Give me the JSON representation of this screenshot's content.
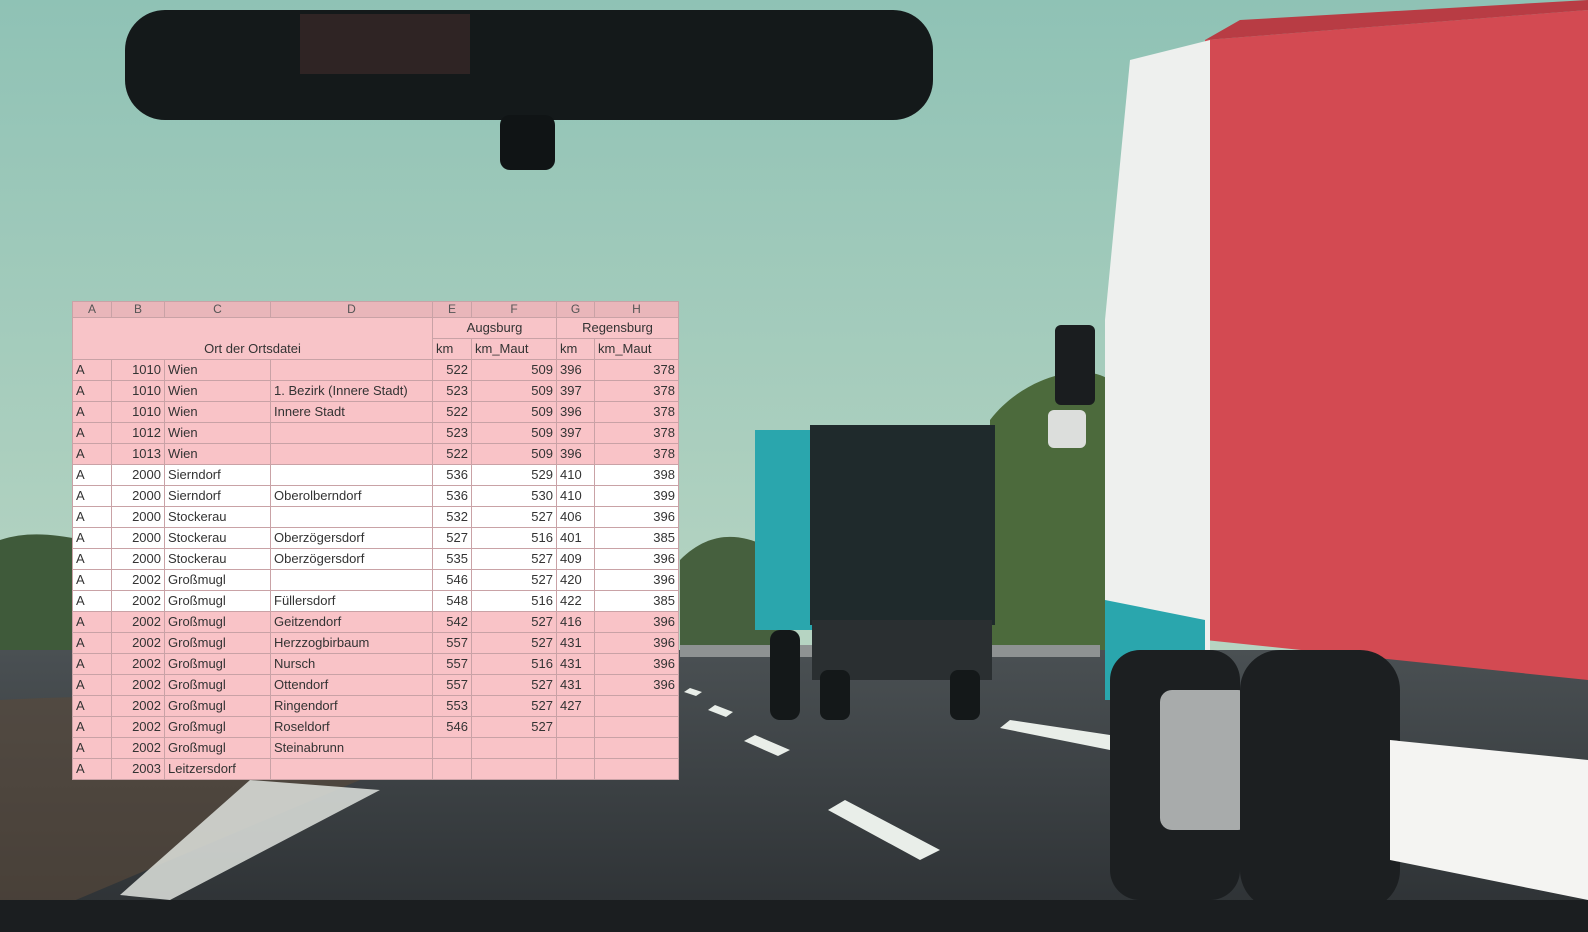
{
  "colors": {
    "sky": "#a9cfc2",
    "road": "#3f4447",
    "pink_row": "#f9c3c7",
    "white_row": "#ffffff",
    "truck_red": "#d34a52",
    "truck_teal": "#2aa6ad"
  },
  "icons": [
    "rearview-mirror",
    "truck-red",
    "truck-teal"
  ],
  "sheet": {
    "columns": [
      "A",
      "B",
      "C",
      "D",
      "E",
      "F",
      "G",
      "H"
    ],
    "header": {
      "group1": "Augsburg",
      "group2": "Regensburg",
      "left_title": "Ort der Ortsdatei",
      "sub": [
        "km",
        "km_Maut",
        "km",
        "km_Maut"
      ]
    },
    "rows": [
      {
        "c": "A",
        "plz": "1010",
        "ort": "Wien",
        "ortsteil": "",
        "e": "522",
        "f": "509",
        "g": "396",
        "h": "378",
        "shade": "pink"
      },
      {
        "c": "A",
        "plz": "1010",
        "ort": "Wien",
        "ortsteil": "1. Bezirk (Innere Stadt)",
        "e": "523",
        "f": "509",
        "g": "397",
        "h": "378",
        "shade": "pink"
      },
      {
        "c": "A",
        "plz": "1010",
        "ort": "Wien",
        "ortsteil": "Innere Stadt",
        "e": "522",
        "f": "509",
        "g": "396",
        "h": "378",
        "shade": "pink"
      },
      {
        "c": "A",
        "plz": "1012",
        "ort": "Wien",
        "ortsteil": "",
        "e": "523",
        "f": "509",
        "g": "397",
        "h": "378",
        "shade": "pink"
      },
      {
        "c": "A",
        "plz": "1013",
        "ort": "Wien",
        "ortsteil": "",
        "e": "522",
        "f": "509",
        "g": "396",
        "h": "378",
        "shade": "pink"
      },
      {
        "c": "A",
        "plz": "2000",
        "ort": "Sierndorf",
        "ortsteil": "",
        "e": "536",
        "f": "529",
        "g": "410",
        "h": "398",
        "shade": "white"
      },
      {
        "c": "A",
        "plz": "2000",
        "ort": "Sierndorf",
        "ortsteil": "Oberolberndorf",
        "e": "536",
        "f": "530",
        "g": "410",
        "h": "399",
        "shade": "white"
      },
      {
        "c": "A",
        "plz": "2000",
        "ort": "Stockerau",
        "ortsteil": "",
        "e": "532",
        "f": "527",
        "g": "406",
        "h": "396",
        "shade": "white"
      },
      {
        "c": "A",
        "plz": "2000",
        "ort": "Stockerau",
        "ortsteil": "Oberzögersdorf",
        "e": "527",
        "f": "516",
        "g": "401",
        "h": "385",
        "shade": "white"
      },
      {
        "c": "A",
        "plz": "2000",
        "ort": "Stockerau",
        "ortsteil": "Oberzögersdorf",
        "e": "535",
        "f": "527",
        "g": "409",
        "h": "396",
        "shade": "white"
      },
      {
        "c": "A",
        "plz": "2002",
        "ort": "Großmugl",
        "ortsteil": "",
        "e": "546",
        "f": "527",
        "g": "420",
        "h": "396",
        "shade": "white"
      },
      {
        "c": "A",
        "plz": "2002",
        "ort": "Großmugl",
        "ortsteil": "Füllersdorf",
        "e": "548",
        "f": "516",
        "g": "422",
        "h": "385",
        "shade": "white"
      },
      {
        "c": "A",
        "plz": "2002",
        "ort": "Großmugl",
        "ortsteil": "Geitzendorf",
        "e": "542",
        "f": "527",
        "g": "416",
        "h": "396",
        "shade": "pink"
      },
      {
        "c": "A",
        "plz": "2002",
        "ort": "Großmugl",
        "ortsteil": "Herzzogbirbaum",
        "e": "557",
        "f": "527",
        "g": "431",
        "h": "396",
        "shade": "pink"
      },
      {
        "c": "A",
        "plz": "2002",
        "ort": "Großmugl",
        "ortsteil": "Nursch",
        "e": "557",
        "f": "516",
        "g": "431",
        "h": "396",
        "shade": "pink"
      },
      {
        "c": "A",
        "plz": "2002",
        "ort": "Großmugl",
        "ortsteil": "Ottendorf",
        "e": "557",
        "f": "527",
        "g": "431",
        "h": "396",
        "shade": "pink"
      },
      {
        "c": "A",
        "plz": "2002",
        "ort": "Großmugl",
        "ortsteil": "Ringendorf",
        "e": "553",
        "f": "527",
        "g": "427",
        "h": "",
        "shade": "pink"
      },
      {
        "c": "A",
        "plz": "2002",
        "ort": "Großmugl",
        "ortsteil": "Roseldorf",
        "e": "546",
        "f": "527",
        "g": "",
        "h": "",
        "shade": "pink"
      },
      {
        "c": "A",
        "plz": "2002",
        "ort": "Großmugl",
        "ortsteil": "Steinabrunn",
        "e": "",
        "f": "",
        "g": "",
        "h": "",
        "shade": "pink"
      },
      {
        "c": "A",
        "plz": "2003",
        "ort": "Leitzersdorf",
        "ortsteil": "",
        "e": "",
        "f": "",
        "g": "",
        "h": "",
        "shade": "pink"
      }
    ]
  }
}
